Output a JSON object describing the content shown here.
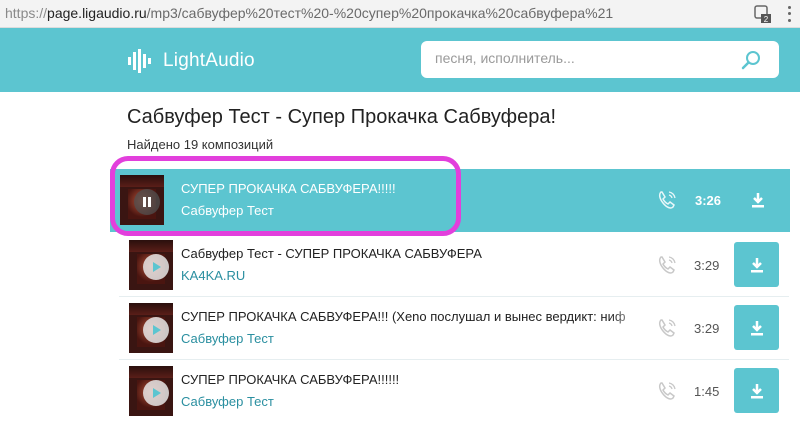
{
  "browser": {
    "url_protocol": "https://",
    "url_host": "page.ligaudio.ru",
    "url_path": "/mp3/сабвуфер%20тест%20-%20супер%20прокачка%20сабвуфера%21",
    "extension_badge": "2"
  },
  "header": {
    "logo_text": "LightAudio",
    "search_placeholder": "песня, исполнитель..."
  },
  "page": {
    "title": "Сабвуфер Тест - Супер Прокачка Сабвуфера!",
    "found": "Найдено 19 композиций"
  },
  "tracks": [
    {
      "title": "СУПЕР ПРОКАЧКА САБВУФЕРА!!!!!",
      "artist": "Сабвуфер Тест",
      "duration": "3:26",
      "state": "playing"
    },
    {
      "title": "Сабвуфер Тест - СУПЕР ПРОКАЧКА САБВУФЕРА",
      "artist": "KA4KA.RU",
      "duration": "3:29",
      "state": "paused"
    },
    {
      "title": "СУПЕР ПРОКАЧКА САБВУФЕРА!!! (Xeno послушал и вынес вердикт: ниф",
      "artist": "Сабвуфер Тест",
      "duration": "3:29",
      "state": "paused"
    },
    {
      "title": "СУПЕР ПРОКАЧКА САБВУФЕРА!!!!!!",
      "artist": "Сабвуфер Тест",
      "duration": "1:45",
      "state": "paused"
    }
  ],
  "colors": {
    "accent": "#5cc5d0",
    "link": "#2a8fa0",
    "annotation": "#e23fdc"
  },
  "icons": {
    "logo": "sound-wave-icon",
    "search": "search-icon",
    "phone": "phone-icon",
    "download": "download-icon",
    "play": "play-icon",
    "pause": "pause-icon"
  }
}
